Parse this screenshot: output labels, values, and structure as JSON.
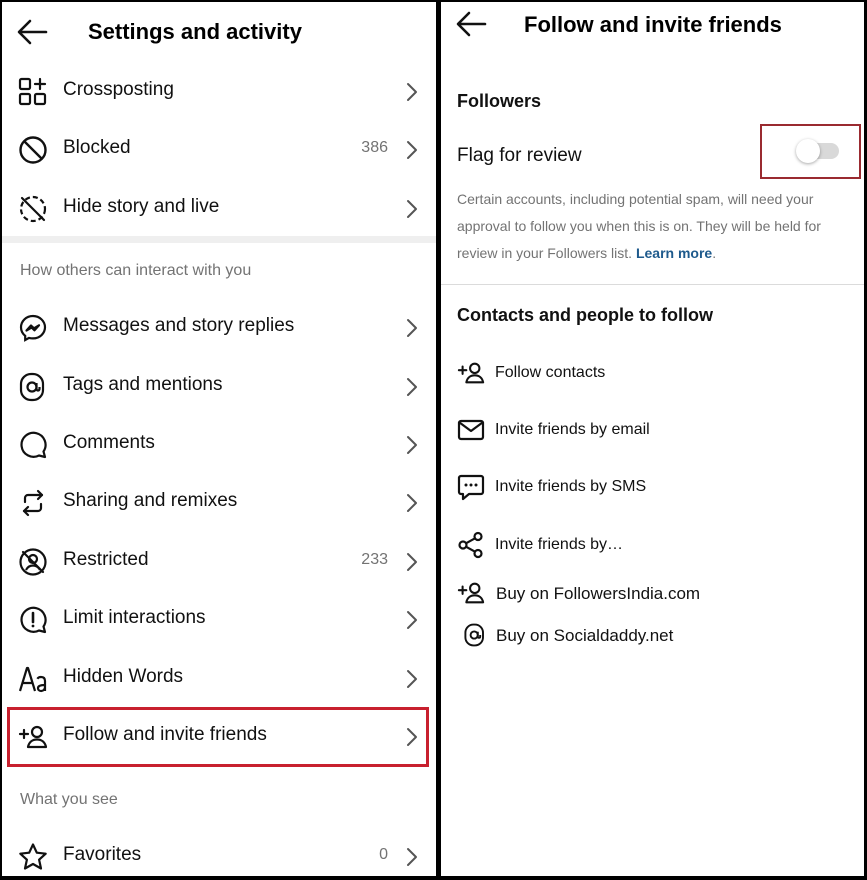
{
  "left": {
    "title": "Settings and activity",
    "items_top": [
      {
        "label": "Crossposting",
        "icon": "crossposting-icon"
      },
      {
        "label": "Blocked",
        "count": "386",
        "icon": "blocked-icon"
      },
      {
        "label": "Hide story and live",
        "icon": "hide-story-icon"
      }
    ],
    "section_interact": "How others can interact with you",
    "items_interact": [
      {
        "label": "Messages and story replies",
        "icon": "messenger-icon"
      },
      {
        "label": "Tags and mentions",
        "icon": "at-sign-icon"
      },
      {
        "label": "Comments",
        "icon": "comment-icon"
      },
      {
        "label": "Sharing and remixes",
        "icon": "repost-icon"
      },
      {
        "label": "Restricted",
        "count": "233",
        "icon": "restricted-icon"
      },
      {
        "label": "Limit interactions",
        "icon": "limit-interactions-icon"
      },
      {
        "label": "Hidden Words",
        "icon": "hidden-words-icon"
      },
      {
        "label": "Follow and invite friends",
        "icon": "add-person-icon"
      }
    ],
    "section_see": "What you see",
    "items_see": [
      {
        "label": "Favorites",
        "count": "0",
        "icon": "star-icon"
      }
    ]
  },
  "right": {
    "title": "Follow and invite friends",
    "section_followers": "Followers",
    "flag_label": "Flag for review",
    "flag_enabled": false,
    "description": "Certain accounts, including potential spam, will need your approval to follow you when this is on. They will be held for review in your Followers list.",
    "learn_more": "Learn more",
    "description_end": ".",
    "section_contacts": "Contacts and people to follow",
    "items": [
      {
        "label": "Follow contacts",
        "icon": "add-person-icon"
      },
      {
        "label": "Invite friends by email",
        "icon": "email-icon"
      },
      {
        "label": "Invite friends by SMS",
        "icon": "sms-icon"
      },
      {
        "label": "Invite friends by…",
        "icon": "share-icon"
      },
      {
        "label": "Buy on FollowersIndia.com",
        "icon": "add-person-icon"
      },
      {
        "label": "Buy on Socialdaddy.net",
        "icon": "at-sign-icon"
      }
    ]
  },
  "colors": {
    "highlight": "#c8202e",
    "link": "#1e5a8c",
    "muted": "#737373"
  }
}
